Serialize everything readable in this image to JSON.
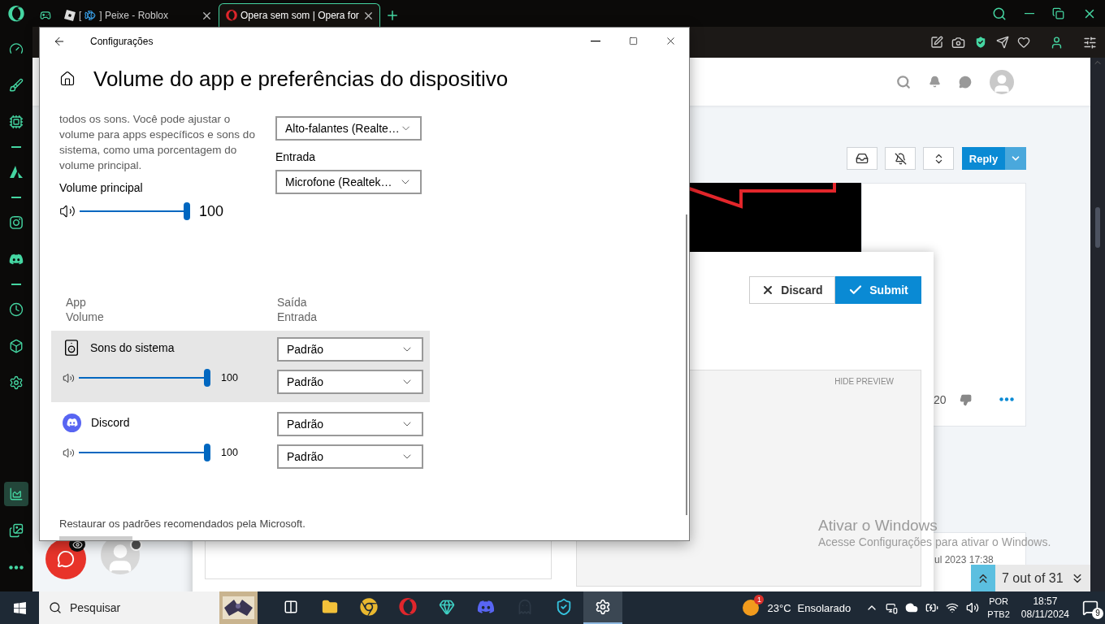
{
  "browser": {
    "tabs": [
      {
        "kind": "icon",
        "selected": false
      },
      {
        "kind": "page",
        "prefix": "[",
        "title": "] Peixe - Roblox",
        "selected": false
      },
      {
        "kind": "page",
        "title": "Opera sem som | Opera for",
        "selected": true
      }
    ]
  },
  "sidebar": {
    "top_items": [
      {
        "kind": "icon",
        "selected": false
      },
      {
        "kind": "icon",
        "selected": false
      },
      {
        "kind": "icon",
        "selected": false
      },
      {
        "kind": "divider"
      },
      {
        "kind": "icon",
        "selected": false
      },
      {
        "kind": "divider"
      },
      {
        "kind": "icon",
        "selected": false
      },
      {
        "kind": "icon",
        "selected": false
      },
      {
        "kind": "divider"
      },
      {
        "kind": "icon",
        "selected": false
      },
      {
        "kind": "icon",
        "selected": false
      },
      {
        "kind": "icon",
        "selected": false
      }
    ],
    "bottom_items": [
      {
        "kind": "icon",
        "selected": true
      },
      {
        "kind": "icon",
        "selected": false
      },
      {
        "kind": "icon",
        "selected": false
      }
    ]
  },
  "forum": {
    "reply_button": "Reply",
    "discard_button": "Discard",
    "submit_button": "Submit",
    "preview_toggle": "HIDE PREVIEW",
    "vote_count": "20",
    "post_date": "ul 2023 17:38",
    "pager": "7 out of 31"
  },
  "settings": {
    "title": "Configurações",
    "heading": "Volume do app e preferências do dispositivo",
    "description": "todos os sons. Você pode ajustar o volume para apps específicos e sons do sistema, como uma porcentagem do volume principal.",
    "master": {
      "label": "Volume principal",
      "level": 1,
      "reading": "100"
    },
    "output_device": "Alto-falantes (Realte…",
    "input_label": "Entrada",
    "input_device": "Microfone (Realtek…",
    "columns": [
      {
        "top": "App",
        "bottom": "Volume"
      },
      {
        "top": "Saída",
        "bottom": "Entrada"
      }
    ],
    "apps": [
      {
        "kind": "system",
        "name": "Sons do sistema",
        "selected": true,
        "level": 1,
        "reading": "100",
        "output": "Padrão",
        "input": "Padrão"
      },
      {
        "kind": "discord",
        "name": "Discord",
        "selected": false,
        "level": 1,
        "reading": "100",
        "output": "Padrão",
        "input": "Padrão"
      }
    ],
    "reset_link": "Restaurar os padrões recomendados pela Microsoft."
  },
  "watermark": {
    "title": "Ativar o Windows",
    "text": "Acesse Configurações para ativar o Windows."
  },
  "taskbar": {
    "search_placeholder": "Pesquisar",
    "apps": [
      {
        "selected": false
      },
      {
        "selected": false
      },
      {
        "selected": false
      },
      {
        "selected": false
      },
      {
        "selected": false
      },
      {
        "selected": false
      },
      {
        "selected": false
      },
      {
        "selected": false
      },
      {
        "selected": true
      }
    ],
    "weather_badge": "1",
    "temperature": "23°C",
    "weather": "Ensolarado",
    "language": "POR",
    "layout": "PTB2",
    "time": "18:57",
    "date": "08/11/2024",
    "notification_count": "9"
  }
}
